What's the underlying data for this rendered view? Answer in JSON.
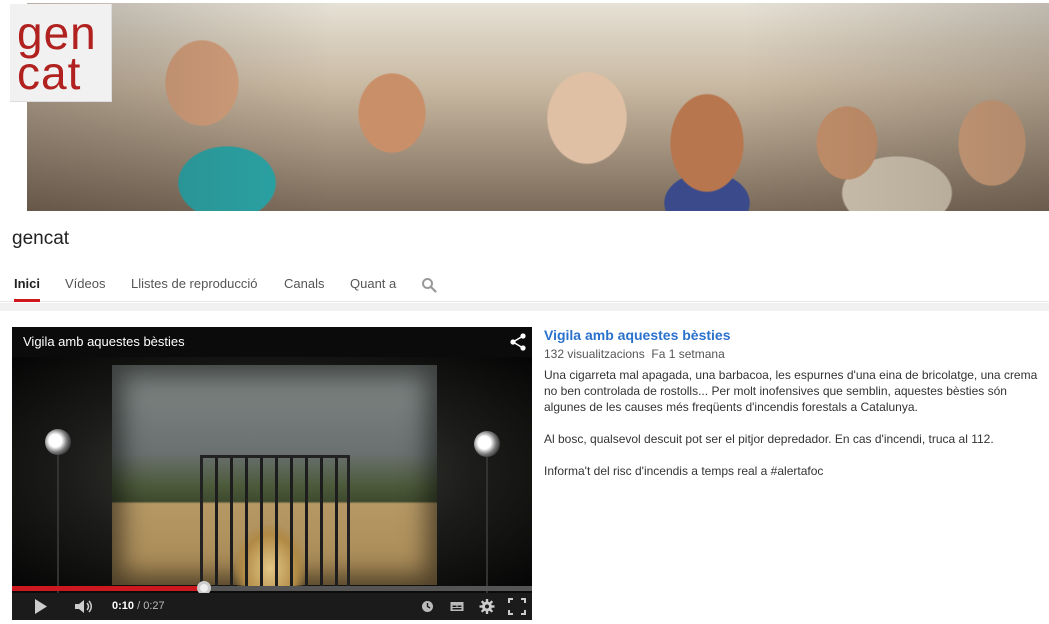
{
  "logo": {
    "line1": "gen",
    "line2": "cat"
  },
  "channel": {
    "name": "gencat"
  },
  "tabs": [
    {
      "label": "Inici",
      "active": true
    },
    {
      "label": "Vídeos",
      "active": false
    },
    {
      "label": "Llistes de reproducció",
      "active": false
    },
    {
      "label": "Canals",
      "active": false
    },
    {
      "label": "Quant a",
      "active": false
    }
  ],
  "search": {
    "icon": "search-icon"
  },
  "player": {
    "title": "Vigila amb aquestes bèsties",
    "current_time": "0:10",
    "duration": "0:27",
    "progress_fraction": 0.37,
    "icons": [
      "share-icon",
      "play-icon",
      "volume-icon",
      "watch-later-icon",
      "captions-icon",
      "settings-icon",
      "fullscreen-icon"
    ]
  },
  "video": {
    "title": "Vigila amb aquestes bèsties",
    "views": "132 visualitzacions",
    "age": "Fa 1 setmana",
    "paragraphs": [
      "Una cigarreta mal apagada, una barbacoa, les espurnes d'una eina de bricolatge, una crema no ben controlada de rostolls... Per molt inofensives que semblin, aquestes bèsties són algunes de les causes més freqüents d'incendis forestals a Catalunya.",
      "Al bosc, qualsevol descuit pot ser el pitjor depredador. En cas d'incendi, truca al 112.",
      "Informa't del risc d'incendis a temps real a #alertafoc"
    ]
  },
  "colors": {
    "accent_red": "#cc181e",
    "link_blue": "#2a72cc",
    "logo_red": "#b0211f"
  }
}
